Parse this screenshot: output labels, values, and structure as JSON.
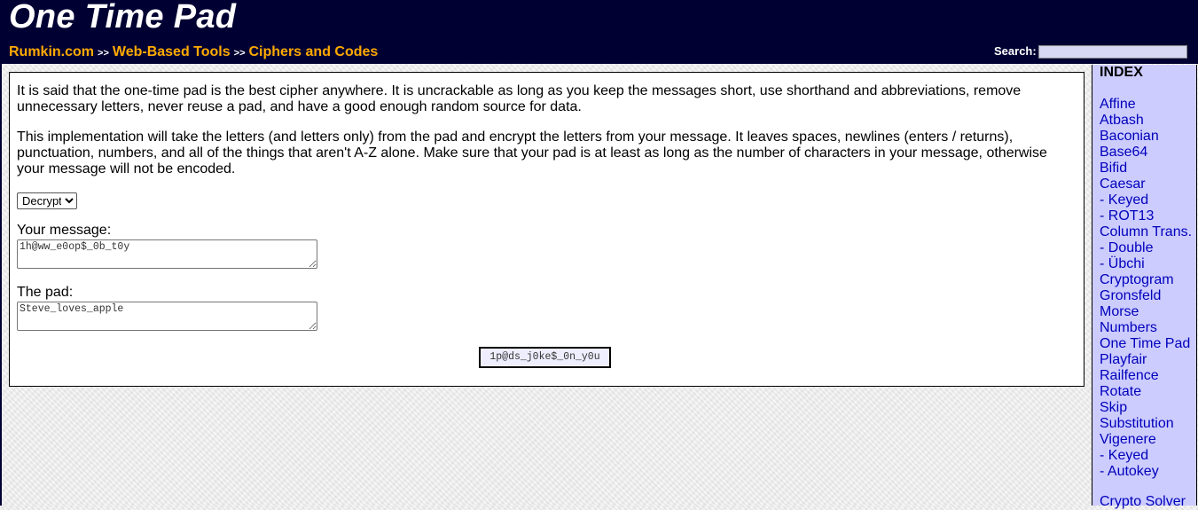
{
  "header": {
    "title": "One Time Pad",
    "breadcrumb": [
      {
        "label": "Rumkin.com"
      },
      {
        "label": "Web-Based Tools"
      },
      {
        "label": "Ciphers and Codes"
      }
    ],
    "separator": ">>",
    "search_label": "Search:"
  },
  "main": {
    "paragraph1": "It is said that the one-time pad is the best cipher anywhere. It is uncrackable as long as you keep the messages short, use shorthand and abbreviations, remove unnecessary letters, never reuse a pad, and have a good enough random source for data.",
    "paragraph2": "This implementation will take the letters (and letters only) from the pad and encrypt the letters from your message. It leaves spaces, newlines (enters / returns), punctuation, numbers, and all of the things that aren't A-Z alone. Make sure that your pad is at least as long as the number of characters in your message, otherwise your message will not be encoded.",
    "mode_select": {
      "selected": "Decrypt"
    },
    "message_label": "Your message:",
    "message_value": "1h@ww_e0op$_0b_t0y",
    "pad_label": "The pad:",
    "pad_value": "Steve_loves_apple",
    "output": "1p@ds_j0ke$_0n_y0u"
  },
  "sidebar": {
    "title": "INDEX",
    "items": [
      "Affine",
      "Atbash",
      "Baconian",
      "Base64",
      "Bifid",
      "Caesar",
      "- Keyed",
      "- ROT13",
      "Column Trans.",
      "- Double",
      "- Übchi",
      "Cryptogram",
      "Gronsfeld",
      "Morse",
      "Numbers",
      "One Time Pad",
      "Playfair",
      "Railfence",
      "Rotate",
      "Skip",
      "Substitution",
      "Vigenere",
      "- Keyed",
      "- Autokey"
    ],
    "extra": "Crypto Solver"
  },
  "colors": {
    "header_bg": "#000033",
    "link_orange": "#ffaa00",
    "sidebar_bg": "#ccccff",
    "sidebar_link": "#0000bb",
    "output_bg": "#eeeeff"
  }
}
